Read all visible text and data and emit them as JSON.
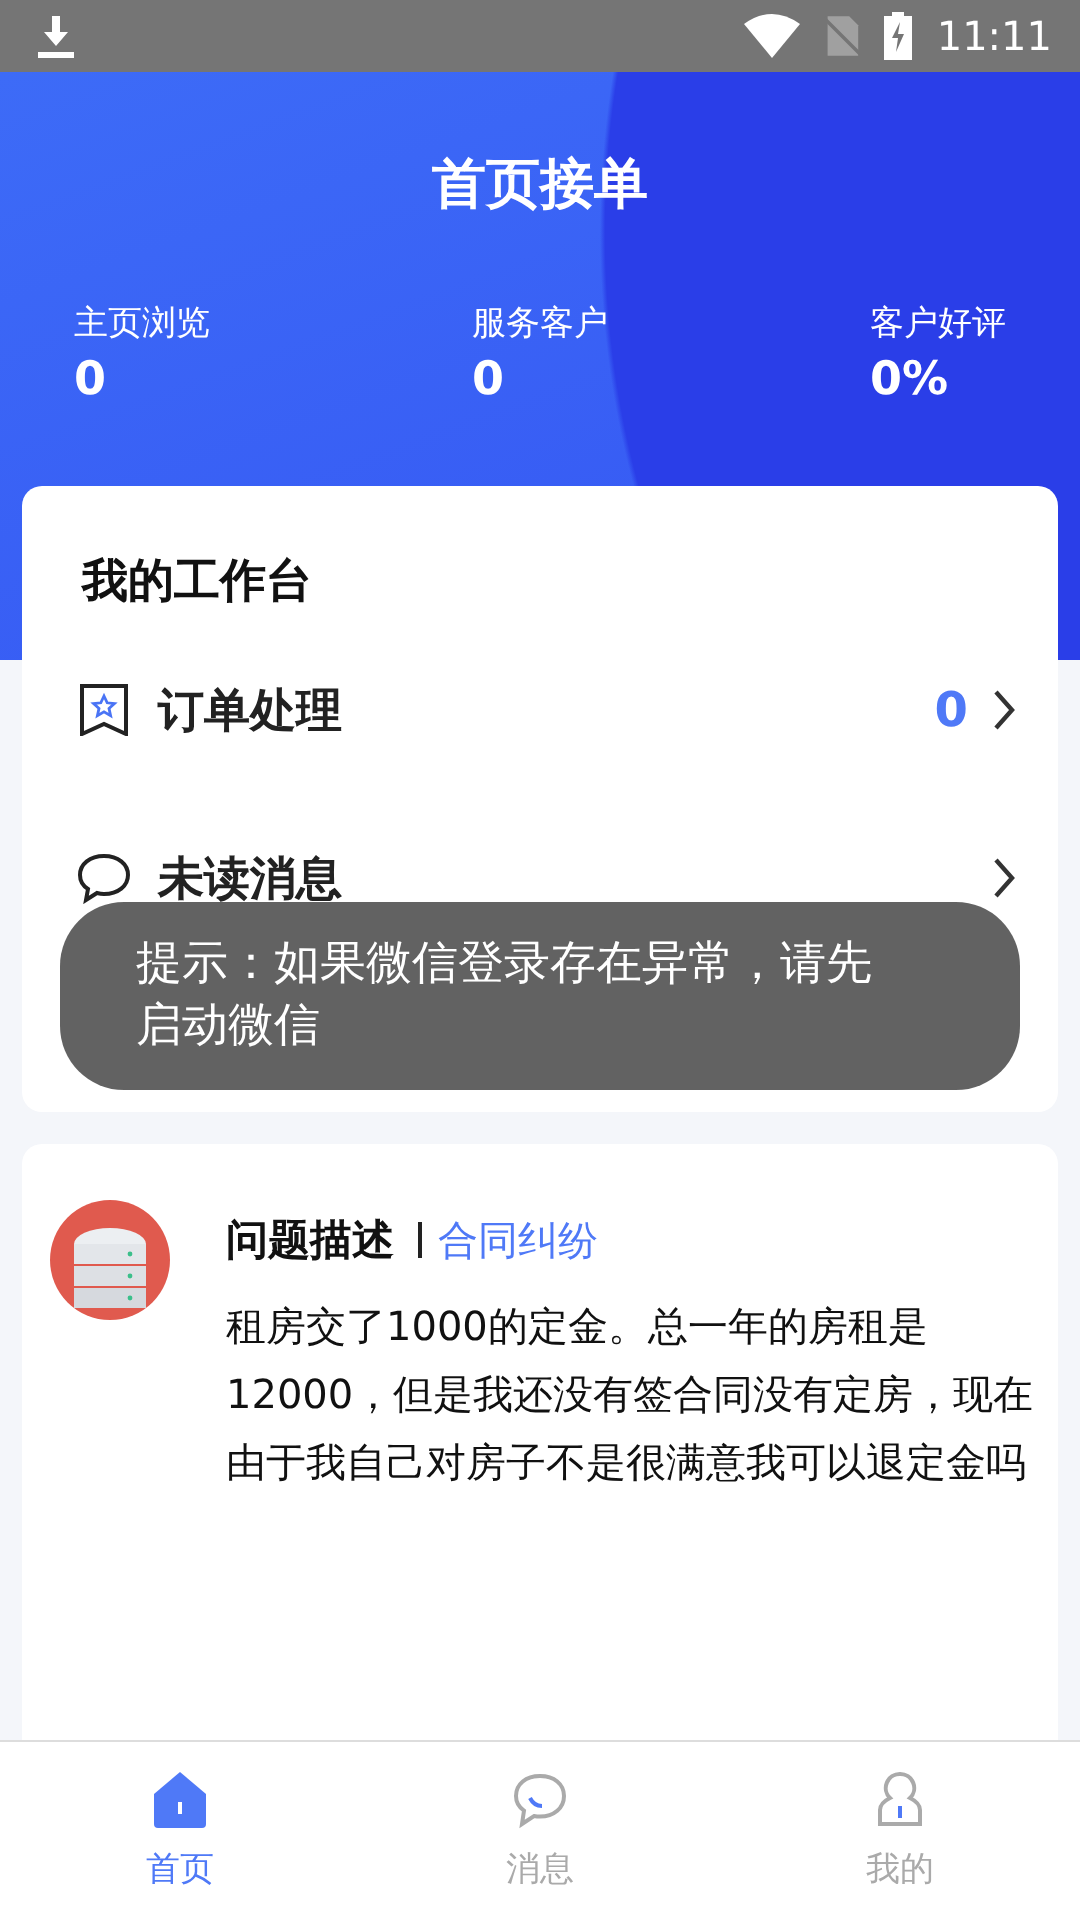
{
  "status_bar": {
    "time": "11:11"
  },
  "header": {
    "title": "首页接单",
    "stats": [
      {
        "label": "主页浏览",
        "value": "0"
      },
      {
        "label": "服务客户",
        "value": "0"
      },
      {
        "label": "客户好评",
        "value": "0%"
      }
    ]
  },
  "workbench": {
    "title": "我的工作台",
    "rows": [
      {
        "label": "订单处理",
        "count": "0"
      },
      {
        "label": "未读消息"
      }
    ]
  },
  "question": {
    "kind": "picture",
    "title": "问题描述",
    "tag": "合同纠纷",
    "text": "租房交了1000的定金。总一年的房租是12000，但是我还没有签合同没有定房，现在由于我自己对房子不是很满意我可以退定金吗"
  },
  "toast": {
    "text": "提示：如果微信登录存在异常，请先启动微信"
  },
  "nav": [
    {
      "label": "首页",
      "selected": true
    },
    {
      "label": "消息",
      "selected": false
    },
    {
      "label": "我的",
      "selected": false
    }
  ]
}
